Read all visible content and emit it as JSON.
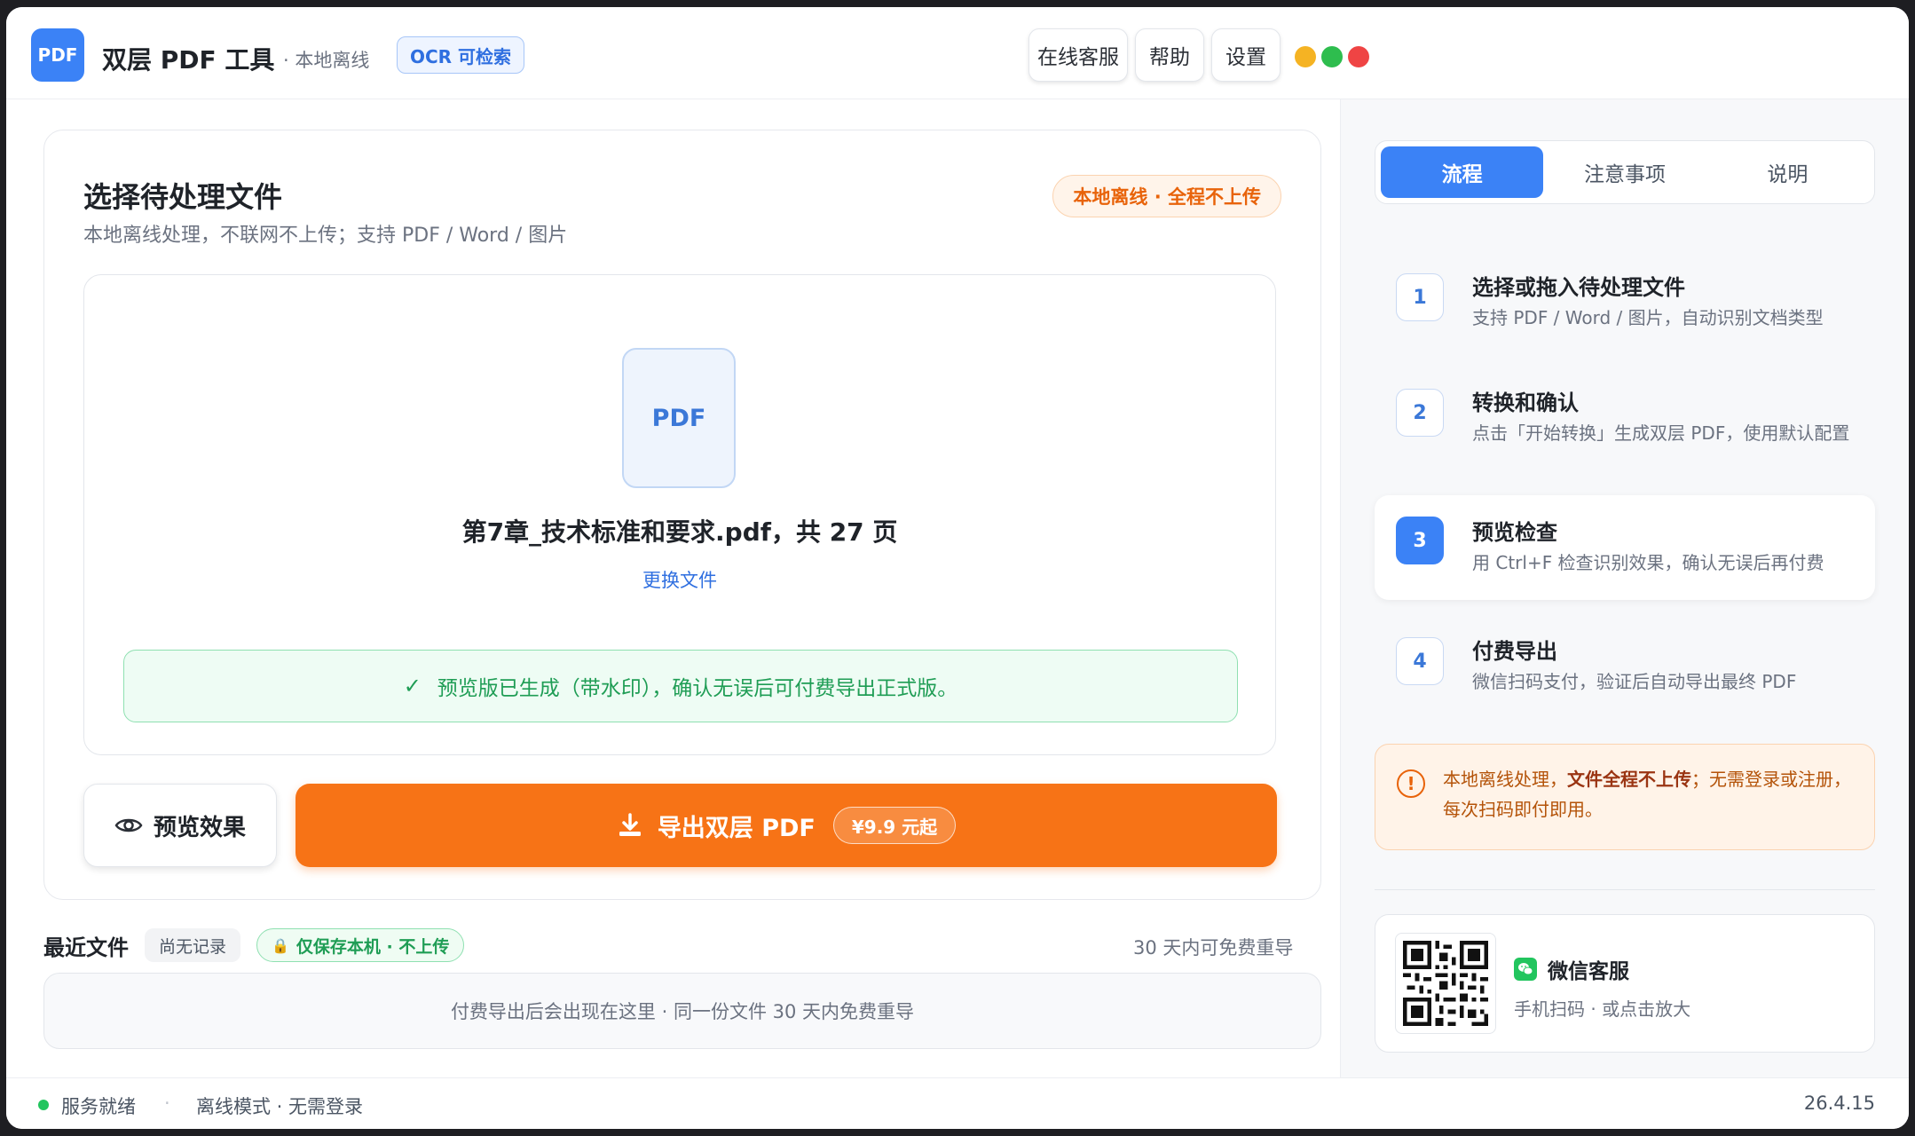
{
  "app": {
    "logo_text": "PDF",
    "title": "双层 PDF 工具",
    "subtitle": "· 本地离线",
    "ocr_badge": "OCR 可检索"
  },
  "toolbar": {
    "support_label": "在线客服",
    "help_label": "帮助",
    "settings_label": "设置"
  },
  "window_controls": {
    "minimize_color": "#f5b323",
    "maximize_color": "#2ebd4e",
    "close_color": "#ef4444"
  },
  "main": {
    "title": "选择待处理文件",
    "subtitle": "本地离线处理，不联网不上传；支持 PDF / Word / 图片",
    "offline_badge": "本地离线 · 全程不上传",
    "file_icon_label": "PDF",
    "file_name": "第7章_技术标准和要求.pdf，共 27 页",
    "change_file": "更换文件",
    "success_message": "预览版已生成（带水印），确认无误后可付费导出正式版。",
    "preview_button": "预览效果",
    "export_button": "导出双层 PDF",
    "export_price": "¥9.9 元起"
  },
  "recent": {
    "title": "最近文件",
    "empty_tag": "尚无记录",
    "local_tag": "仅保存本机 · 不上传",
    "right_note": "30 天内可免费重导",
    "empty_message": "付费导出后会出现在这里 · 同一份文件 30 天内免费重导"
  },
  "side": {
    "tabs": [
      {
        "label": "流程"
      },
      {
        "label": "注意事项"
      },
      {
        "label": "说明"
      }
    ],
    "steps": [
      {
        "num": "1",
        "title": "选择或拖入待处理文件",
        "desc": "支持 PDF / Word / 图片，自动识别文档类型"
      },
      {
        "num": "2",
        "title": "转换和确认",
        "desc": "点击「开始转换」生成双层 PDF，使用默认配置"
      },
      {
        "num": "3",
        "title": "预览检查",
        "desc": "用 Ctrl+F 检查识别效果，确认无误后再付费"
      },
      {
        "num": "4",
        "title": "付费导出",
        "desc": "微信扫码支付，验证后自动导出最终 PDF"
      }
    ],
    "notice": {
      "part1": "本地离线处理，",
      "bold": "文件全程不上传",
      "part2": "；无需登录或注册，每次扫码即付即用。"
    },
    "wechat": {
      "title": "微信客服",
      "subtitle": "手机扫码 · 或点击放大"
    }
  },
  "status": {
    "ready": "服务就绪",
    "separator": "·",
    "mode": "离线模式 · 无需登录",
    "version": "26.4.15"
  },
  "colors": {
    "accent_blue": "#3b82f6",
    "accent_orange": "#f77316",
    "success_green": "#1f9d55"
  }
}
